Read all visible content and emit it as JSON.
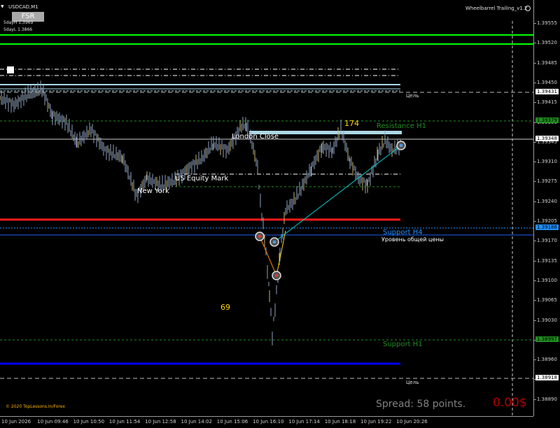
{
  "window": {
    "symbol_title": "USDCAD,M1",
    "fsr_button": "FSR",
    "sday_high": "5dayH 1.3969",
    "sday_low": "5dayL 1.3866",
    "ea_title": "Wheelbarrel Trailing_v1.2",
    "copyright": "© 2020 TopLessons.In/Forex",
    "spread": "Spread: 58 points.",
    "profit": "0.00$"
  },
  "price_axis": {
    "labels": [
      "1.39555",
      "1.39520",
      "1.39485",
      "1.39450",
      "1.39415",
      "1.39380",
      "1.39345",
      "1.39310",
      "1.39275",
      "1.39240",
      "1.39205",
      "1.39170",
      "1.39135",
      "1.39100",
      "1.39065",
      "1.39030",
      "1.38995",
      "1.38960",
      "1.38925",
      "1.38890"
    ],
    "tags": {
      "target_upper": "1.39431",
      "resistance_h1": "1.39379",
      "current": "1.39348",
      "support_h4": "1.39186",
      "lower_green": "1.38997",
      "target_lower": "1.38918"
    }
  },
  "time_axis": {
    "labels": [
      "10 Jun 2026",
      "10 Jun 09:46",
      "10 Jun 10:50",
      "10 Jun 11:54",
      "10 Jun 12:58",
      "10 Jun 14:02",
      "10 Jun 15:06",
      "10 Jun 16:10",
      "10 Jun 17:14",
      "10 Jun 18:18",
      "10 Jun 19:22",
      "10 Jun 20:26"
    ]
  },
  "annotations": {
    "target_upper_label": "Цель",
    "target_lower_label": "Цель",
    "resistance_h1": "Resistance H1",
    "support_h4": "Support H4",
    "general_price_level": "Уровень общей цены",
    "support_h1": "Support H1",
    "london_close": "London Close",
    "us_equity_market": "US Equity Mark",
    "new_york": "New York",
    "count_upper": "174",
    "count_lower": "69"
  },
  "colors": {
    "candles": "#8fa3c0",
    "candle_accent": "#c8b46e",
    "green_line": "#00ff00",
    "resistance": "#1f8f1f",
    "support_h4": "#1e90ff",
    "red_level": "#ff1a1a",
    "blue_level": "#0000ff"
  }
}
